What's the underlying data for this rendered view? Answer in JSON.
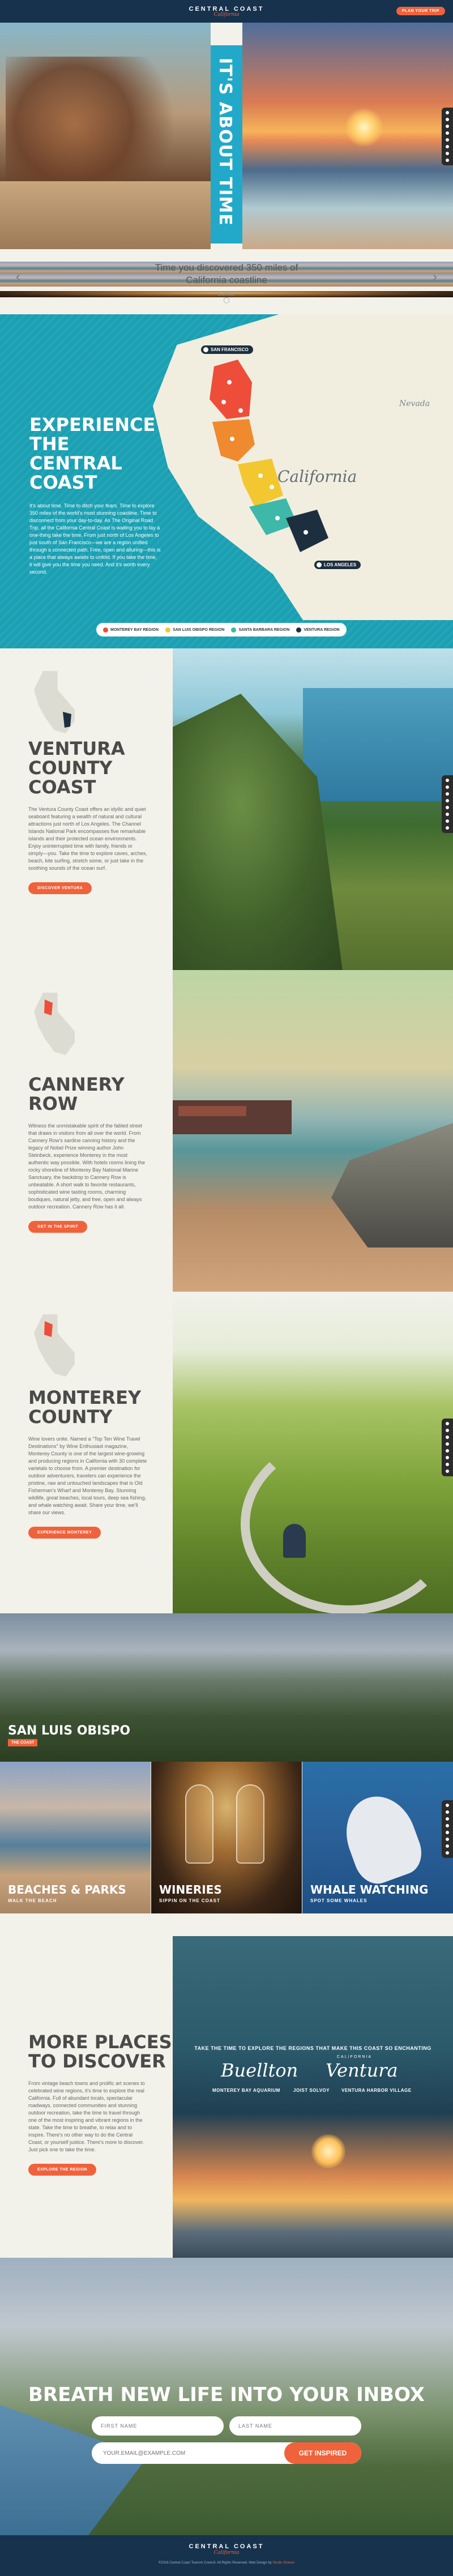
{
  "header": {
    "brand_top": "CENTRAL COAST",
    "brand_script": "California",
    "plan_button": "PLAN YOUR TRIP"
  },
  "hero": {
    "vertical_text": "IT'S ABOUT TIME"
  },
  "timebar": {
    "line1": "Time you discovered 350 miles of",
    "line2": "California coastline",
    "script": "Scroll"
  },
  "experience": {
    "title_line1": "EXPERIENCE THE",
    "title_line2": "CENTRAL COAST",
    "body": "It's about time. Time to ditch your fears. Time to explore 350 miles of the world's most stunning coastline. Time to disconnect from your day-to-day. As The Original Road Trip, all the California Central Coast is waiting you to lay a one-thing take the time. From just north of Los Angeles to just south of San Francisco—we are a region unified through a connected path. Free, open and alluring—this is a place that always awaits to unfold. If you take the time, it will give you the time you need. And it's worth every second.",
    "state_label": "California",
    "neighbor_label": "Nevada",
    "city_north": "SAN FRANCISCO",
    "city_south": "LOS ANGELES",
    "colors": {
      "red": "#ee4d3a",
      "orange": "#f08a2e",
      "yellow": "#f3c72f",
      "teal": "#3db8a9",
      "dark": "#1d2f3e"
    },
    "legend": [
      {
        "label": "MONTEREY BAY REGION",
        "color": "#ee4d3a"
      },
      {
        "label": "SAN LUIS OBISPO REGION",
        "color": "#f3c72f"
      },
      {
        "label": "SANTA BARBARA REGION",
        "color": "#3db8a9"
      },
      {
        "label": "VENTURA REGION",
        "color": "#1d2f3e"
      }
    ]
  },
  "ventura": {
    "title_line1": "VENTURA",
    "title_line2": "COUNTY COAST",
    "body": "The Ventura County Coast offers an idyllic and quiet seaboard featuring a wealth of natural and cultural attractions just north of Los Angeles. The Channel Islands National Park encompasses five remarkable islands and their protected ocean environments. Enjoy uninterrupted time with family, friends or simply—you. Take the time to explore caves, arches, beach, kite surfing, stretch some, or just take in the soothing sounds of the ocean surf.",
    "button": "DISCOVER VENTURA"
  },
  "cannery": {
    "title": "CANNERY ROW",
    "body": "Witness the unmistakable spirit of the fabled street that draws in visitors from all over the world. From Cannery Row's sardine canning history and the legacy of Nobel Prize winning author John Steinbeck, experience Monterey in the most authentic way possible. With hotels rooms lining the rocky shoreline of Monterey Bay National Marine Sanctuary, the backdrop to Cannery Row is unbeatable. A short walk to favorite restaurants, sophisticated wine tasting rooms, charming boutiques, natural jetty, and free, open and always outdoor recreation. Cannery Row has it all.",
    "button": "GET IN THE SPIRIT"
  },
  "monterey": {
    "title_line1": "MONTEREY",
    "title_line2": "COUNTY",
    "body": "Wine lovers unite. Named a \"Top Ten Wine Travel Destinations\" by Wine Enthusiast magazine, Monterey County is one of the largest wine-growing and producing regions in California with 30 complete varietals to choose from. A premier destination for outdoor adventurers, travelers can experience the pristine, raw and untouched landscapes that is Old Fisherman's Wharf and Monterey Bay. Stunning wildlife, great beaches, local tours, deep sea fishing, and whale watching await. Share your time, we'll share our views.",
    "button": "EXPERIENCE MONTEREY"
  },
  "slo": {
    "title": "SAN LUIS OBISPO",
    "badge": "THE COAST",
    "tiles": [
      {
        "title": "BEACHES & PARKS",
        "sub": "WALK THE BEACH"
      },
      {
        "title": "WINERIES",
        "sub": "SIPPIN ON THE COAST"
      },
      {
        "title": "WHALE WATCHING",
        "sub": "SPOT SOME WHALES"
      }
    ]
  },
  "more": {
    "title_line1": "MORE PLACES",
    "title_line2": "TO DISCOVER",
    "body": "From vintage beach towns and prolific art scenes to celebrated wine regions, it's time to explore the real California. Full of abundant locals, spectacular roadways, connected communities and stunning outdoor recreation, take the time to travel through one of the most inspiring and vibrant regions in the state. Take the time to breathe, to relax and to inspire. There's no other way to do the Central Coast, or yourself justice. There's more to discover. Just pick one to take the time.",
    "link1": "beach towns",
    "button": "EXPLORE THE REGION",
    "caption": "TAKE THE TIME TO EXPLORE THE REGIONS THAT MAKE THIS COAST SO ENCHANTING",
    "city1": "Buellton",
    "city2": "Ventura",
    "city2_over": "CALIFORNIA",
    "subs": [
      "MONTEREY BAY AQUARIUM",
      "JOIST SOLVOY",
      "VENTURA HARBOR VILLAGE"
    ]
  },
  "newsletter": {
    "title": "BREATH NEW LIFE INTO YOUR INBOX",
    "first_name": "FIRST NAME",
    "last_name": "LAST NAME",
    "email": "YOUR.EMAIL@EXAMPLE.COM",
    "button": "GET INSPIRED"
  },
  "footer": {
    "brand_top": "CENTRAL COAST",
    "brand_script": "California",
    "copyright": "©2016 Central Coast Tourism Council. All Rights Reserved. Web Design by",
    "credit": "Studio Sixteen"
  }
}
